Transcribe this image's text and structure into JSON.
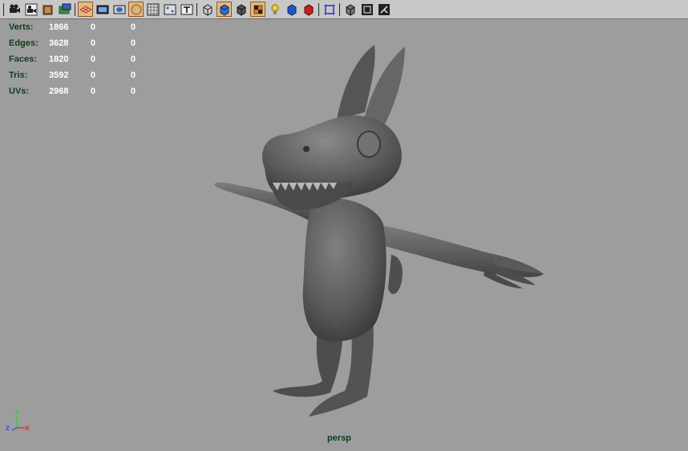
{
  "toolbar": {
    "icons": [
      "camera-icon",
      "camera-attributes-icon",
      "bookmark-icon",
      "image-plane-icon",
      "grid-icon",
      "film-gate-icon",
      "resolution-gate-icon",
      "safe-action-icon",
      "field-chart-icon",
      "safe-title-icon",
      "text-icon",
      "wireframe-icon",
      "smooth-shade-icon",
      "bounding-box-icon",
      "texture-icon",
      "lighting-icon",
      "shadow-icon",
      "xray-icon",
      "isolate-icon",
      "cube-wire-icon",
      "frame-icon",
      "manipulator-icon"
    ]
  },
  "hud": {
    "rows": [
      {
        "label": "Verts:",
        "v1": "1866",
        "v2": "0",
        "v3": "0"
      },
      {
        "label": "Edges:",
        "v1": "3628",
        "v2": "0",
        "v3": "0"
      },
      {
        "label": "Faces:",
        "v1": "1820",
        "v2": "0",
        "v3": "0"
      },
      {
        "label": "Tris:",
        "v1": "3592",
        "v2": "0",
        "v3": "0"
      },
      {
        "label": "UVs:",
        "v1": "2968",
        "v2": "0",
        "v3": "0"
      }
    ]
  },
  "camera": {
    "name": "persp"
  },
  "axis": {
    "x": "x",
    "y": "Y",
    "z": "z",
    "x_color": "#e33030",
    "y_color": "#2fd04c",
    "z_color": "#3a50ff"
  }
}
